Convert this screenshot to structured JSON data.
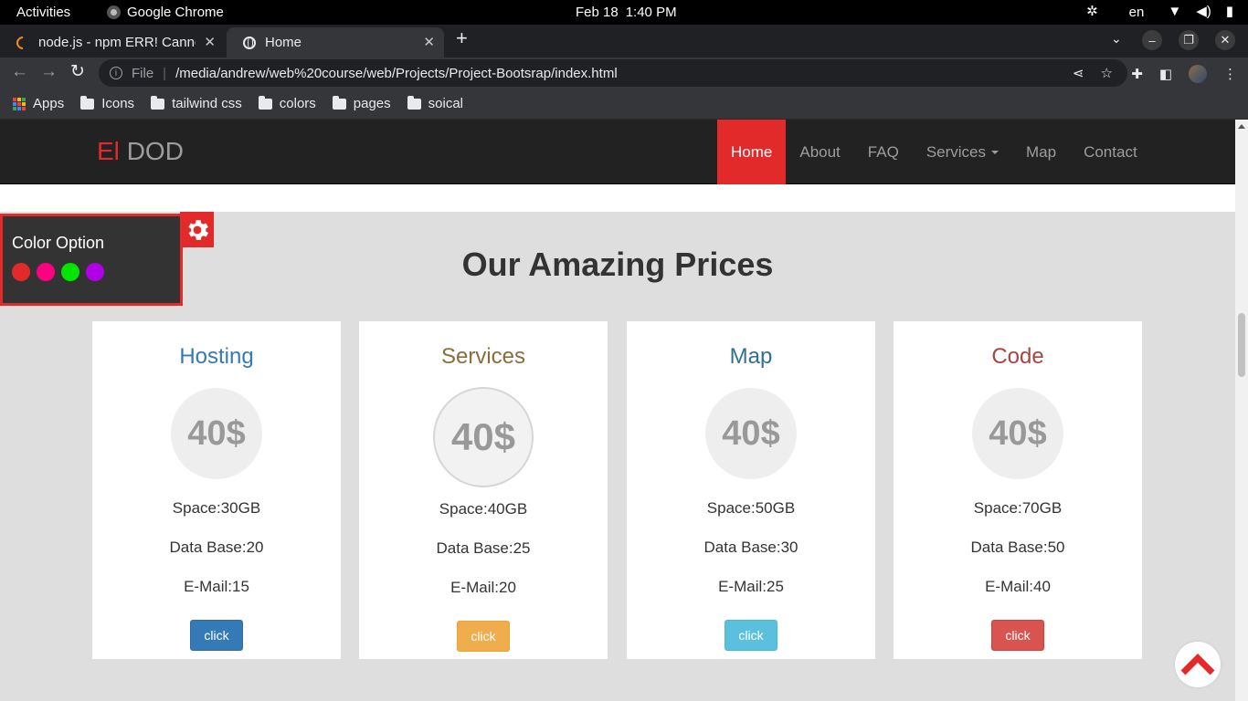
{
  "os": {
    "activities": "Activities",
    "app_name": "Google Chrome",
    "date": "Feb 18",
    "time": "1:40 PM",
    "lang": "en"
  },
  "browser": {
    "tabs": [
      {
        "title": "node.js - npm ERR! Cannot",
        "icon": "loading-spinner-icon"
      },
      {
        "title": "Home",
        "icon": "globe-icon"
      }
    ],
    "omnibox": {
      "scheme_label": "File",
      "url": "/media/andrew/web%20course/web/Projects/Project-Bootsrap/index.html"
    },
    "bookmarks": [
      {
        "label": "Apps",
        "icon": "apps-grid-icon"
      },
      {
        "label": "Icons",
        "icon": "folder-icon"
      },
      {
        "label": "tailwind css",
        "icon": "folder-icon"
      },
      {
        "label": "colors",
        "icon": "folder-icon"
      },
      {
        "label": "pages",
        "icon": "folder-icon"
      },
      {
        "label": "soical",
        "icon": "folder-icon"
      }
    ]
  },
  "site": {
    "brand_accent": "El",
    "brand_rest": "DOD",
    "accent_color": "#e22a2a",
    "menu": [
      {
        "label": "Home",
        "active": true
      },
      {
        "label": "About"
      },
      {
        "label": "FAQ"
      },
      {
        "label": "Services",
        "dropdown": true
      },
      {
        "label": "Map"
      },
      {
        "label": "Contact"
      }
    ],
    "color_option": {
      "title": "Color Option",
      "swatches": [
        "#e22a2a",
        "#ff0080",
        "#00e600",
        "#b000e6"
      ]
    },
    "section_title": "Our Amazing Prices",
    "plans": [
      {
        "title": "Hosting",
        "title_color": "#337ab7",
        "price": "40$",
        "space": "Space:30GB",
        "database": "Data Base:20",
        "email": "E-Mail:15",
        "button": "click"
      },
      {
        "title": "Services",
        "title_color": "#8a6d3b",
        "price": "40$",
        "space": "Space:40GB",
        "database": "Data Base:25",
        "email": "E-Mail:20",
        "button": "click"
      },
      {
        "title": "Map",
        "title_color": "#31708f",
        "price": "40$",
        "space": "Space:50GB",
        "database": "Data Base:30",
        "email": "E-Mail:25",
        "button": "click"
      },
      {
        "title": "Code",
        "title_color": "#a94442",
        "price": "40$",
        "space": "Space:70GB",
        "database": "Data Base:50",
        "email": "E-Mail:40",
        "button": "click"
      }
    ]
  }
}
